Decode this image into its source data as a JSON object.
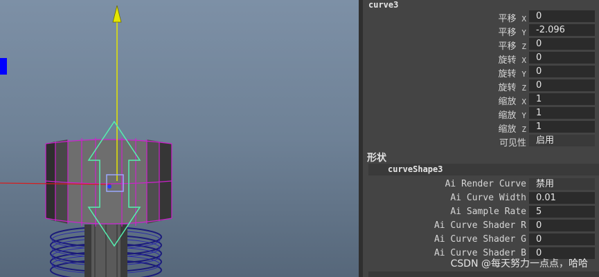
{
  "viewport": {
    "background_top": "#7d90a6",
    "background_bottom": "#56677a",
    "accent_magenta": "#cc22cc",
    "manipulator_green": "#55f0b0",
    "axis_y_color": "#e6e600",
    "axis_x_color": "#d81c1c"
  },
  "attributes": {
    "node_name": "curve3",
    "rows": [
      {
        "label": "平移",
        "axis": "X",
        "value": "0"
      },
      {
        "label": "平移",
        "axis": "Y",
        "value": "-2.096"
      },
      {
        "label": "平移",
        "axis": "Z",
        "value": "0"
      },
      {
        "label": "旋转",
        "axis": "X",
        "value": "0"
      },
      {
        "label": "旋转",
        "axis": "Y",
        "value": "0"
      },
      {
        "label": "旋转",
        "axis": "Z",
        "value": "0"
      },
      {
        "label": "缩放",
        "axis": "X",
        "value": "1"
      },
      {
        "label": "缩放",
        "axis": "Y",
        "value": "1"
      },
      {
        "label": "缩放",
        "axis": "Z",
        "value": "1"
      },
      {
        "label": "可见性",
        "axis": "",
        "value": "启用"
      }
    ],
    "shape_section": "形状",
    "shape_name": "curveShape3",
    "shape_rows": [
      {
        "label": "Ai Render Curve",
        "value": "禁用"
      },
      {
        "label": "Ai Curve Width",
        "value": "0.01"
      },
      {
        "label": "Ai Sample Rate",
        "value": "5"
      },
      {
        "label": "Ai Curve Shader R",
        "value": "0"
      },
      {
        "label": "Ai Curve Shader G",
        "value": "0"
      },
      {
        "label": "Ai Curve Shader B",
        "value": "0"
      }
    ]
  },
  "watermark": "CSDN @每天努力一点点，哈哈"
}
